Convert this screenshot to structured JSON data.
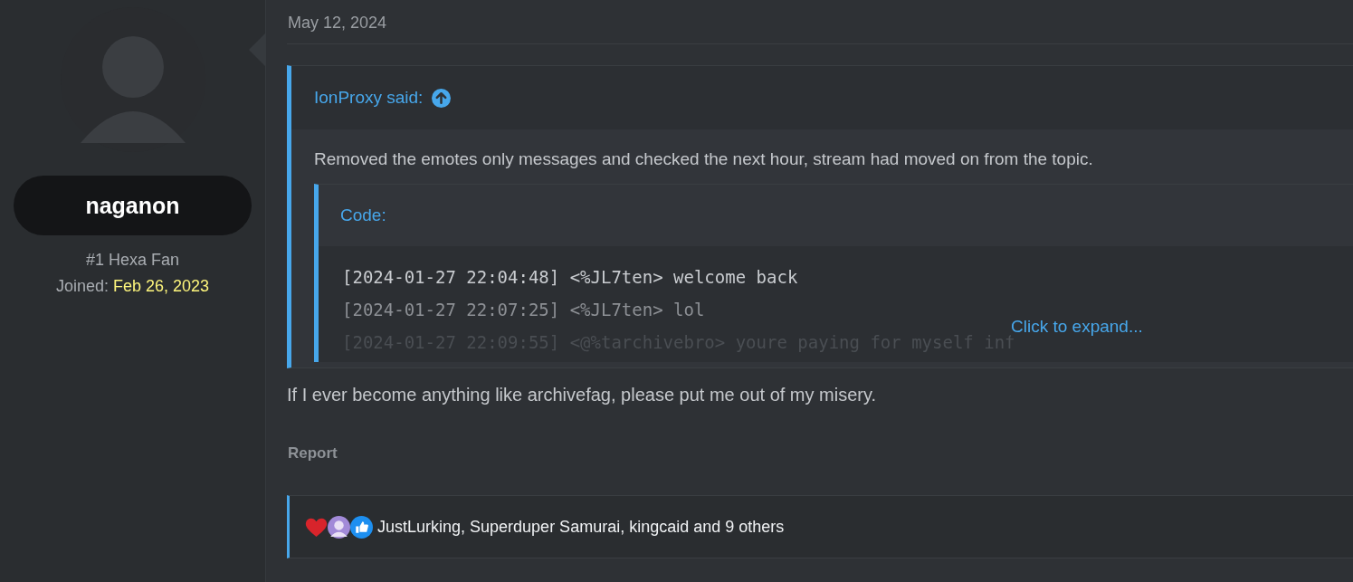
{
  "user": {
    "name": "naganon",
    "title": "#1 Hexa Fan",
    "joined_label": "Joined:",
    "joined_date": "Feb 26, 2023"
  },
  "post": {
    "date": "May 12, 2024",
    "quote": {
      "author": "IonProxy said:",
      "body": "Removed the emotes only messages and checked the next hour, stream had moved on from the topic.",
      "code": {
        "label": "Code:",
        "lines": [
          "[2024-01-27 22:04:48] <%JL7ten> welcome back",
          "[2024-01-27 22:07:25] <%JL7ten> lol",
          "[2024-01-27 22:09:55] <@%tarchivebro> youre paying for myself inf"
        ],
        "expand": "Click to expand..."
      }
    },
    "text": "If I ever become anything like archivefag, please put me out of my misery.",
    "report": "Report",
    "reactions": {
      "summary": "JustLurking, Superduper Samurai, kingcaid and 9 others"
    }
  }
}
